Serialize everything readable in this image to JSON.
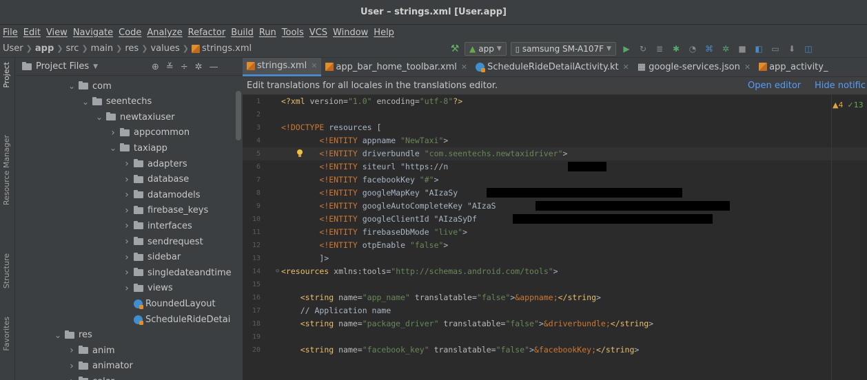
{
  "window": {
    "title": "User – strings.xml [User.app]"
  },
  "menu": [
    "File",
    "Edit",
    "View",
    "Navigate",
    "Code",
    "Analyze",
    "Refactor",
    "Build",
    "Run",
    "Tools",
    "VCS",
    "Window",
    "Help"
  ],
  "breadcrumb": [
    "User",
    "app",
    "src",
    "main",
    "res",
    "values",
    "strings.xml"
  ],
  "toolbar": {
    "run_config": "app",
    "device": "samsung SM-A107F"
  },
  "sidebar_tabs": [
    "Project",
    "Resource Manager",
    "Structure",
    "Favorites"
  ],
  "project_panel": {
    "header": "Project Files",
    "tree": [
      {
        "label": "com",
        "depth": 0,
        "kind": "folder",
        "open": true
      },
      {
        "label": "seentechs",
        "depth": 1,
        "kind": "folder",
        "open": true
      },
      {
        "label": "newtaxiuser",
        "depth": 2,
        "kind": "folder",
        "open": true
      },
      {
        "label": "appcommon",
        "depth": 3,
        "kind": "folder",
        "open": false
      },
      {
        "label": "taxiapp",
        "depth": 3,
        "kind": "folder",
        "open": true
      },
      {
        "label": "adapters",
        "depth": 4,
        "kind": "folder",
        "open": false
      },
      {
        "label": "database",
        "depth": 4,
        "kind": "folder",
        "open": false
      },
      {
        "label": "datamodels",
        "depth": 4,
        "kind": "folder",
        "open": false
      },
      {
        "label": "firebase_keys",
        "depth": 4,
        "kind": "folder",
        "open": false
      },
      {
        "label": "interfaces",
        "depth": 4,
        "kind": "folder",
        "open": false
      },
      {
        "label": "sendrequest",
        "depth": 4,
        "kind": "folder",
        "open": false
      },
      {
        "label": "sidebar",
        "depth": 4,
        "kind": "folder",
        "open": false
      },
      {
        "label": "singledateandtime",
        "depth": 4,
        "kind": "folder",
        "open": false
      },
      {
        "label": "views",
        "depth": 4,
        "kind": "folder",
        "open": false
      },
      {
        "label": "RoundedLayout",
        "depth": 4,
        "kind": "kotlin",
        "open": false
      },
      {
        "label": "ScheduleRideDetai",
        "depth": 4,
        "kind": "kotlin",
        "open": false
      },
      {
        "label": "res",
        "depth": -1,
        "kind": "folder",
        "open": true
      },
      {
        "label": "anim",
        "depth": 0,
        "kind": "folder",
        "open": false
      },
      {
        "label": "animator",
        "depth": 0,
        "kind": "folder",
        "open": false
      },
      {
        "label": "color",
        "depth": 0,
        "kind": "folder",
        "open": false
      }
    ]
  },
  "editor": {
    "tabs": [
      {
        "label": "strings.xml",
        "active": true
      },
      {
        "label": "app_bar_home_toolbar.xml",
        "active": false
      },
      {
        "label": "ScheduleRideDetailActivity.kt",
        "active": false
      },
      {
        "label": "google-services.json",
        "active": false
      },
      {
        "label": "app_activity_",
        "active": false
      }
    ],
    "notification": {
      "text": "Edit translations for all locales in the translations editor.",
      "open_link": "Open editor",
      "hide_link": "Hide notific"
    },
    "inspections": {
      "warnings": "4",
      "weak_warnings": "13"
    },
    "lines": [
      {
        "n": "1",
        "text": "<?xml version=\"1.0\" encoding=\"utf-8\"?>"
      },
      {
        "n": "2",
        "text": ""
      },
      {
        "n": "3",
        "text": "<!DOCTYPE resources ["
      },
      {
        "n": "4",
        "text": "        <!ENTITY appname \"NewTaxi\">"
      },
      {
        "n": "5",
        "text": "        <!ENTITY driverbundle \"com.seentechs.newtaxidriver\">"
      },
      {
        "n": "6",
        "text": "        <!ENTITY siteurl \"https://n"
      },
      {
        "n": "7",
        "text": "        <!ENTITY facebookKey \"#\">"
      },
      {
        "n": "8",
        "text": "        <!ENTITY googleMapKey \"AIzaSy"
      },
      {
        "n": "9",
        "text": "        <!ENTITY googleAutoCompleteKey \"AIzaS"
      },
      {
        "n": "10",
        "text": "        <!ENTITY googleClientId \"AIzaSyDf"
      },
      {
        "n": "11",
        "text": "        <!ENTITY firebaseDbMode \"live\">"
      },
      {
        "n": "12",
        "text": "        <!ENTITY otpEnable \"false\">"
      },
      {
        "n": "13",
        "text": "        ]>"
      },
      {
        "n": "14",
        "text": "<resources xmlns:tools=\"http://schemas.android.com/tools\">"
      },
      {
        "n": "15",
        "text": ""
      },
      {
        "n": "16",
        "text": "    <string name=\"app_name\" translatable=\"false\">&appname;</string>"
      },
      {
        "n": "17",
        "text": "    // Application name"
      },
      {
        "n": "18",
        "text": "    <string name=\"package_driver\" translatable=\"false\">&driverbundle;</string>"
      },
      {
        "n": "19",
        "text": ""
      },
      {
        "n": "20",
        "text": "    <string name=\"facebook_key\" translatable=\"false\">&facebookKey;</string>"
      }
    ]
  },
  "colors": {
    "background": "#2b2b2b",
    "panel": "#3c3f41",
    "accent": "#4a88c7",
    "link": "#589df6",
    "xml_tag": "#e8bf6a",
    "string": "#6a8759",
    "keyword": "#cc7832"
  },
  "icons": [
    "folder-icon",
    "kotlin-file-icon",
    "xml-file-icon",
    "json-file-icon",
    "hammer-icon",
    "run-icon",
    "debug-icon",
    "bulb-icon",
    "gear-icon",
    "collapse-icon",
    "target-icon"
  ]
}
